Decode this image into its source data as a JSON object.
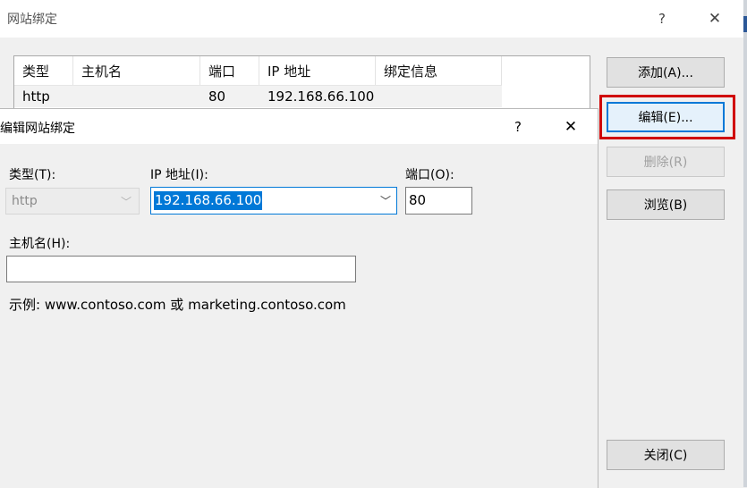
{
  "outer_dialog": {
    "title": "网站绑定",
    "help_glyph": "?",
    "close_glyph": "✕",
    "table": {
      "columns": [
        "类型",
        "主机名",
        "端口",
        "IP 地址",
        "绑定信息"
      ],
      "rows": [
        {
          "type": "http",
          "host": "",
          "port": "80",
          "ip": "192.168.66.100",
          "info": ""
        }
      ]
    },
    "buttons": {
      "add": "添加(A)...",
      "edit": "编辑(E)...",
      "remove": "删除(R)",
      "browse": "浏览(B)",
      "close": "关闭(C)"
    },
    "highlight_color": "#d00000"
  },
  "edit_dialog": {
    "title": "编辑网站绑定",
    "help_glyph": "?",
    "close_glyph": "✕",
    "type_label": "类型(T):",
    "type_value": "http",
    "ip_label": "IP 地址(I):",
    "ip_value": "192.168.66.100",
    "port_label": "端口(O):",
    "port_value": "80",
    "host_label": "主机名(H):",
    "host_value": "",
    "example_text": "示例: www.contoso.com 或 marketing.contoso.com",
    "dropdown_glyph": "﹀"
  },
  "colors": {
    "accent": "#0078d7",
    "dialog_bg": "#f0f0f0"
  }
}
